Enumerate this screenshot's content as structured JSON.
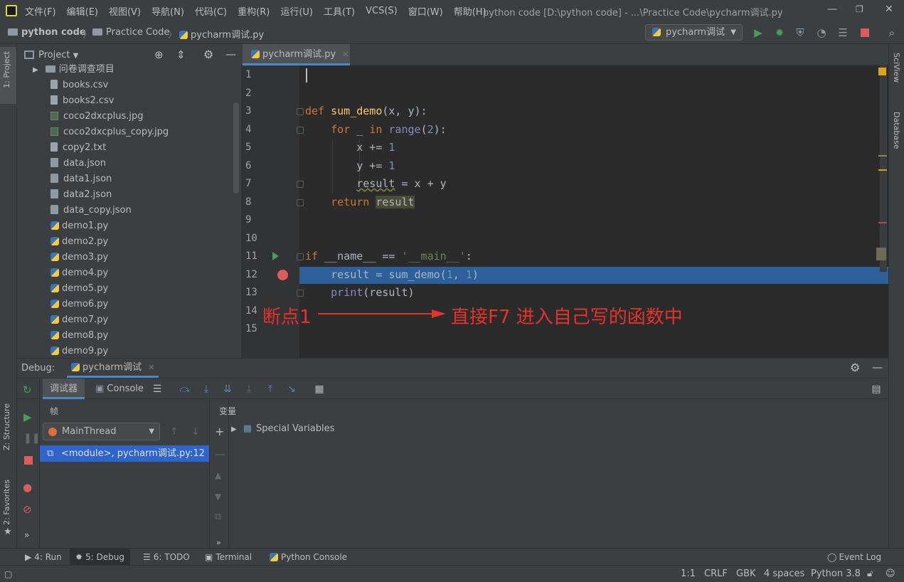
{
  "menu": [
    "文件(F)",
    "编辑(E)",
    "视图(V)",
    "导航(N)",
    "代码(C)",
    "重构(R)",
    "运行(U)",
    "工具(T)",
    "VCS(S)",
    "窗口(W)",
    "帮助(H)"
  ],
  "window_title": "python code [D:\\python code] - ...\\Practice Code\\pycharm调试.py",
  "breadcrumb": {
    "root": "python code",
    "folder": "Practice Code",
    "file": "pycharm调试.py"
  },
  "run_config": "pycharm调试",
  "side_tabs": {
    "project": "1: Project",
    "structure": "Z: Structure",
    "favorites": "2: Favorites",
    "sciview": "SciView",
    "database": "Database"
  },
  "project": {
    "title": "Project",
    "tree": [
      {
        "label": "问卷调查项目",
        "kind": "folder"
      },
      {
        "label": "books.csv",
        "kind": "file"
      },
      {
        "label": "books2.csv",
        "kind": "file"
      },
      {
        "label": "coco2dxcplus.jpg",
        "kind": "image"
      },
      {
        "label": "coco2dxcplus_copy.jpg",
        "kind": "image"
      },
      {
        "label": "copy2.txt",
        "kind": "file"
      },
      {
        "label": "data.json",
        "kind": "json"
      },
      {
        "label": "data1.json",
        "kind": "json"
      },
      {
        "label": "data2.json",
        "kind": "json"
      },
      {
        "label": "data_copy.json",
        "kind": "json"
      },
      {
        "label": "demo1.py",
        "kind": "py"
      },
      {
        "label": "demo2.py",
        "kind": "py"
      },
      {
        "label": "demo3.py",
        "kind": "py"
      },
      {
        "label": "demo4.py",
        "kind": "py"
      },
      {
        "label": "demo5.py",
        "kind": "py"
      },
      {
        "label": "demo6.py",
        "kind": "py"
      },
      {
        "label": "demo7.py",
        "kind": "py"
      },
      {
        "label": "demo8.py",
        "kind": "py"
      },
      {
        "label": "demo9.py",
        "kind": "py"
      }
    ]
  },
  "editor": {
    "tab": "pycharm调试.py",
    "line_numbers": [
      "1",
      "2",
      "3",
      "4",
      "5",
      "6",
      "7",
      "8",
      "9",
      "10",
      "11",
      "12",
      "13",
      "14",
      "15"
    ]
  },
  "annotation": {
    "left": "断点1",
    "right": "直接F7 进入自己写的函数中"
  },
  "debug": {
    "label": "Debug:",
    "session_tab": "pycharm调试",
    "tab_debugger": "调试器",
    "tab_console": "Console",
    "frames_header": "帧",
    "thread": "MainThread",
    "frame": "<module>, pycharm调试.py:12",
    "vars_header": "变量",
    "special_vars": "Special Variables"
  },
  "bottom_tools": {
    "run": "4: Run",
    "debug": "5: Debug",
    "todo": "6: TODO",
    "terminal": "Terminal",
    "python_console": "Python Console",
    "event_log": "Event Log"
  },
  "status": {
    "position": "1:1",
    "line_sep": "CRLF",
    "encoding": "GBK",
    "indent": "4 spaces",
    "interpreter": "Python 3.8"
  },
  "colors": {
    "keyword": "#cc7832",
    "function": "#ffc66d",
    "number": "#6897bb",
    "string": "#6a8759",
    "selection": "#2d5f9a",
    "annotation": "#e5332a",
    "breakpoint": "#db5c5c"
  }
}
